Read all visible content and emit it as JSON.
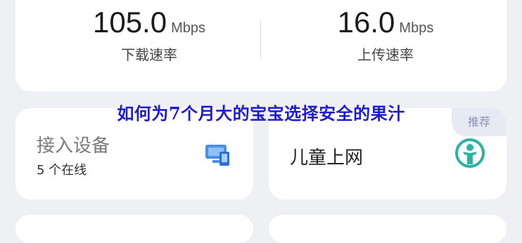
{
  "speed": {
    "download": {
      "value": "105.0",
      "unit": "Mbps",
      "label": "下载速率"
    },
    "upload": {
      "value": "16.0",
      "unit": "Mbps",
      "label": "上传速率"
    }
  },
  "overlay": {
    "title": "如何为7个月大的宝宝选择安全的果汁"
  },
  "devices": {
    "title": "接入设备",
    "subtitle": "5 个在线",
    "icon": "devices-icon"
  },
  "child_mode": {
    "title": "儿童上网",
    "badge": "推荐",
    "icon": "child-icon"
  },
  "colors": {
    "accent": "#1c1ad6",
    "icon_blue": "#2f86e8",
    "icon_teal": "#2bb3a2"
  }
}
